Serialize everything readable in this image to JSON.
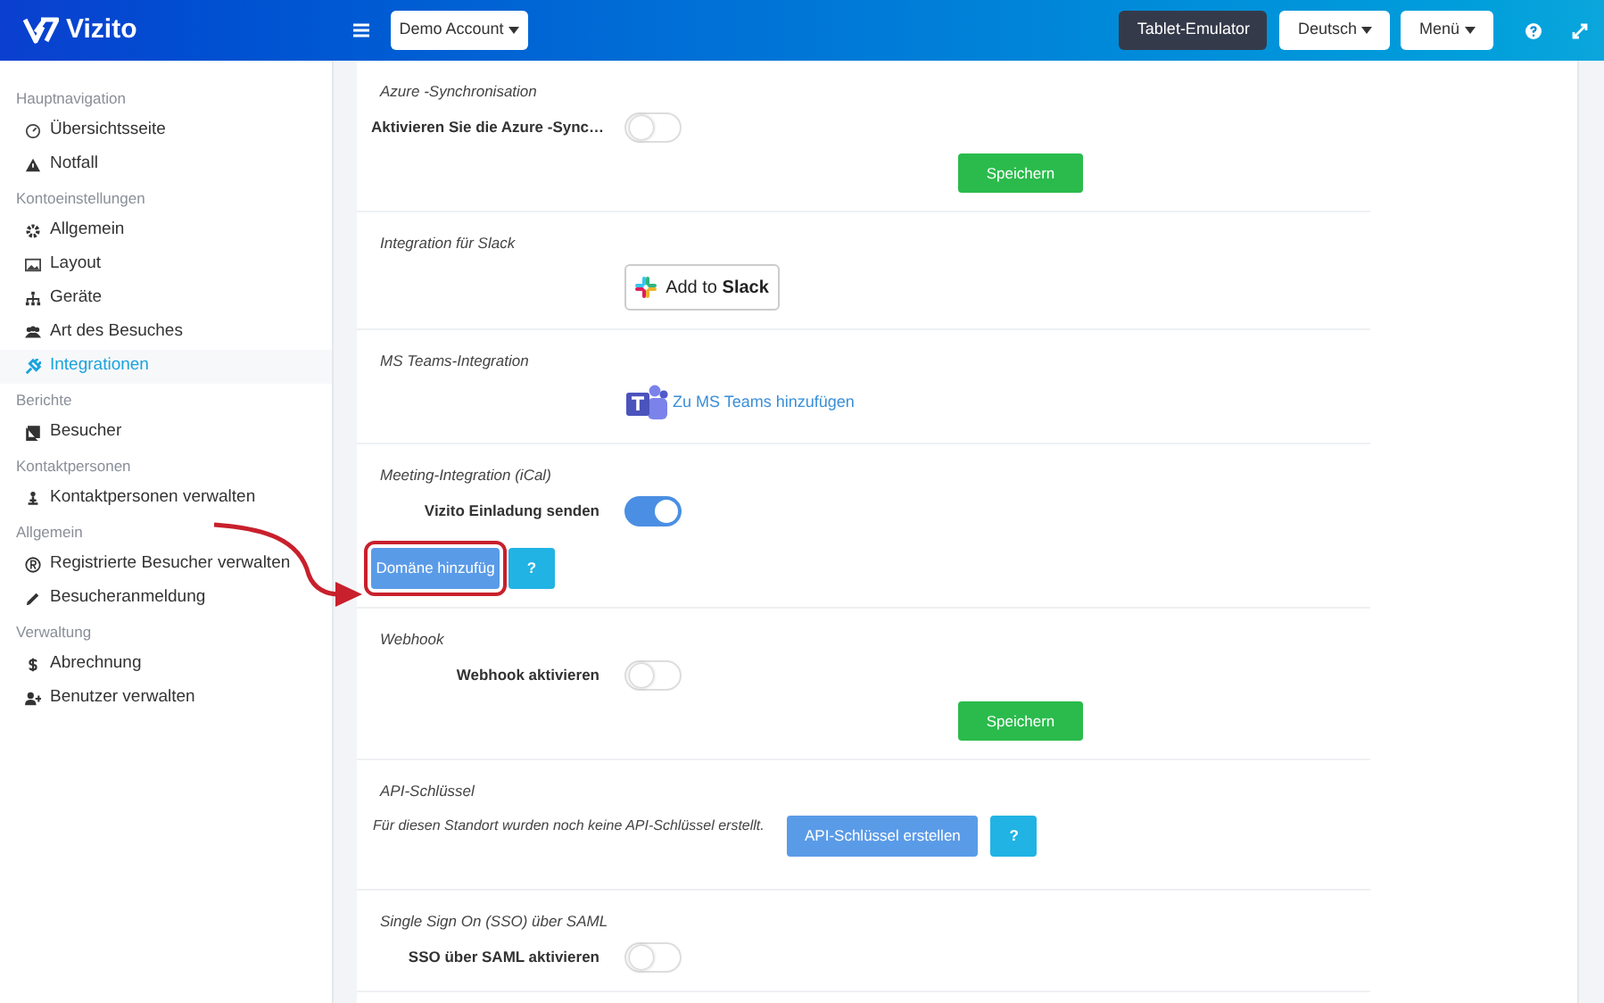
{
  "header": {
    "logo": "Vizito",
    "account": "Demo Account",
    "buttons": [
      {
        "label": "Tablet-Emulator",
        "kind": "dark"
      },
      {
        "label": "Deutsch",
        "kind": "dropdown"
      },
      {
        "label": "Menü",
        "kind": "dropdown"
      }
    ]
  },
  "sidebar": {
    "groups": [
      {
        "title": "Hauptnavigation",
        "items": [
          {
            "label": "Übersichtsseite",
            "selected": false
          },
          {
            "label": "Notfall",
            "selected": false
          }
        ]
      },
      {
        "title": "Kontoeinstellungen",
        "items": [
          {
            "label": "Allgemein",
            "selected": false
          },
          {
            "label": "Layout",
            "selected": false
          },
          {
            "label": "Geräte",
            "selected": false
          },
          {
            "label": "Art des Besuches",
            "selected": false
          },
          {
            "label": "Integrationen",
            "selected": true
          }
        ]
      },
      {
        "title": "Berichte",
        "items": [
          {
            "label": "Besucher",
            "selected": false
          }
        ]
      },
      {
        "title": "Kontaktpersonen",
        "items": [
          {
            "label": "Kontaktpersonen verwalten",
            "selected": false
          }
        ]
      },
      {
        "title": "Allgemein",
        "items": [
          {
            "label": "Registrierte Besucher verwalten",
            "selected": false
          },
          {
            "label": "Besucheranmeldung",
            "selected": false
          }
        ]
      },
      {
        "title": "Verwaltung",
        "items": [
          {
            "label": "Abrechnung",
            "selected": false
          },
          {
            "label": "Benutzer verwalten",
            "selected": false
          }
        ]
      }
    ]
  },
  "sections": [
    {
      "title": "Azure -Synchronisation",
      "rows": [
        {
          "kind": "toggle",
          "label": "Aktivieren Sie die Azure -Sync…",
          "on": false
        },
        {
          "kind": "save",
          "label": "Speichern"
        }
      ]
    },
    {
      "title": "Integration für Slack",
      "rows": [
        {
          "kind": "slack",
          "label": "Add to **Slack**"
        }
      ]
    },
    {
      "title": "MS Teams-Integration",
      "rows": [
        {
          "kind": "teams",
          "label": "Zu MS Teams hinzufügen"
        }
      ]
    },
    {
      "title": "Meeting-Integration (iCal)",
      "rows": [
        {
          "kind": "toggle",
          "label": "Vizito Einladung senden",
          "on": true
        },
        {
          "kind": "buttons",
          "buttons": [
            {
              "label": "Domäne hinzufüg",
              "kind": "primary",
              "highlighted": true
            },
            {
              "label": "?",
              "kind": "help",
              "highlighted": false
            }
          ]
        }
      ]
    },
    {
      "title": "Webhook",
      "rows": [
        {
          "kind": "toggle",
          "label": "Webhook aktivieren",
          "on": false
        },
        {
          "kind": "save",
          "label": "Speichern"
        }
      ]
    },
    {
      "title": "API-Schlüssel",
      "rows": [
        {
          "kind": "note",
          "text": "Für diesen Standort wurden noch keine API-Schlüssel erstellt.",
          "buttons": [
            {
              "label": "API-Schlüssel erstellen",
              "kind": "primary",
              "highlighted": false
            },
            {
              "label": "?",
              "kind": "help",
              "highlighted": false
            }
          ]
        }
      ]
    },
    {
      "title": "Single Sign On (SSO) über SAML",
      "rows": [
        {
          "kind": "toggle",
          "label": "SSO über SAML aktivieren",
          "on": false
        }
      ]
    }
  ]
}
